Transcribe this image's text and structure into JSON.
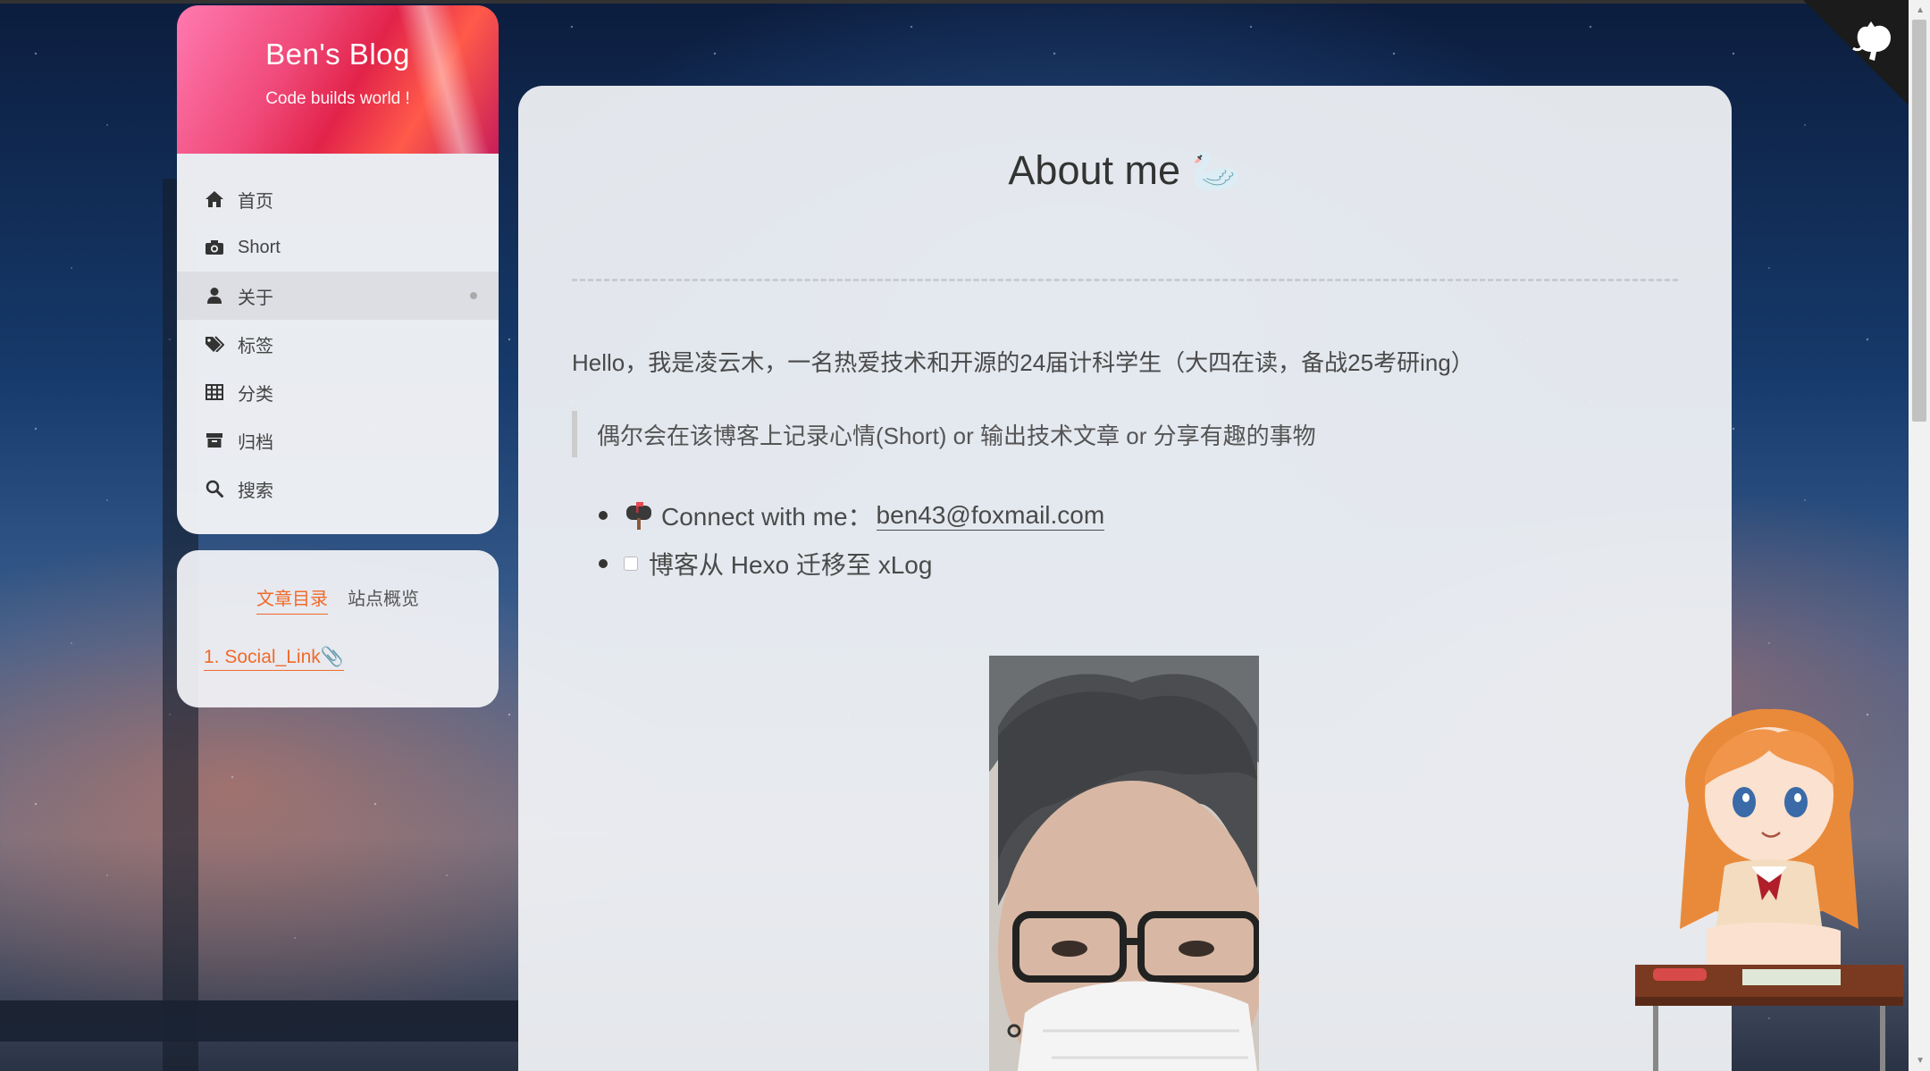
{
  "blog": {
    "title": "Ben's Blog",
    "subtitle": "Code builds world !"
  },
  "menu": {
    "items": [
      {
        "label": "首页",
        "icon": "home-icon"
      },
      {
        "label": "Short",
        "icon": "camera-icon"
      },
      {
        "label": "关于",
        "icon": "user-icon",
        "active": true
      },
      {
        "label": "标签",
        "icon": "tags-icon"
      },
      {
        "label": "分类",
        "icon": "grid-icon"
      },
      {
        "label": "归档",
        "icon": "archive-icon"
      },
      {
        "label": "搜索",
        "icon": "search-icon"
      }
    ]
  },
  "toc": {
    "tabs": [
      "文章目录",
      "站点概览"
    ],
    "active_tab": "文章目录",
    "links": [
      "1. Social_Link📎"
    ]
  },
  "post": {
    "title": "About me 🦢",
    "intro": "Hello，我是凌云木，一名热爱技术和开源的24届计科学生（大四在读，备战25考研ing）",
    "quote": "偶尔会在该博客上记录心情(Short) or 输出技术文章 or 分享有趣的事物",
    "list": {
      "connect_prefix": "Connect with me：",
      "email": "ben43@foxmail.com",
      "todo": "博客从 Hexo 迁移至 xLog"
    }
  },
  "colors": {
    "accent": "#f06a2a",
    "brand_gradient": [
      "#ff7ab0",
      "#e2234a"
    ],
    "card_bg": "#f0f2f5"
  }
}
